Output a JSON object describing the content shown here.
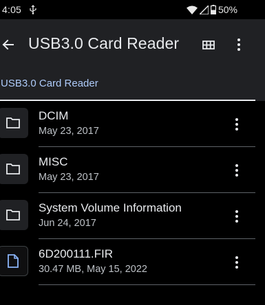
{
  "status_bar": {
    "time": "4:05",
    "battery": "50%",
    "icons": [
      "usb-icon",
      "wifi-icon",
      "cell-signal-icon",
      "battery-icon"
    ]
  },
  "app_bar": {
    "title": "USB3.0 Card Reader",
    "icons": [
      "back-arrow-icon",
      "grid-view-icon",
      "more-vert-icon"
    ]
  },
  "breadcrumb": {
    "label": "USB3.0 Card Reader",
    "accent_color": "#aecbfa"
  },
  "files": [
    {
      "name": "DCIM",
      "meta": "May 23, 2017",
      "icon": "folder-icon"
    },
    {
      "name": "MISC",
      "meta": "May 23, 2017",
      "icon": "folder-icon"
    },
    {
      "name": "System Volume Information",
      "meta": "Jun 24, 2017",
      "icon": "folder-icon"
    },
    {
      "name": "6D200111.FIR",
      "meta": "30.47 MB, May 15, 2022",
      "icon": "file-icon"
    }
  ]
}
